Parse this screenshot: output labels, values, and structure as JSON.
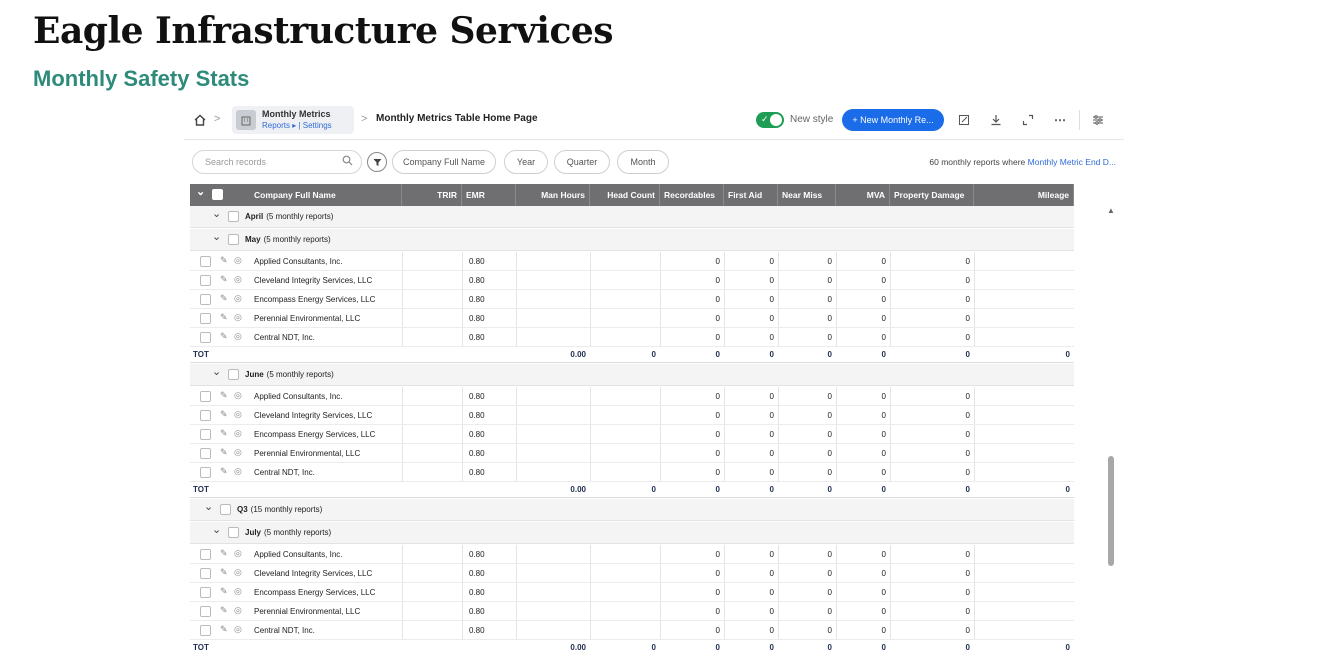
{
  "page": {
    "title": "Eagle Infrastructure Services",
    "subtitle": "Monthly Safety Stats"
  },
  "topbar": {
    "app_name": "Monthly Metrics",
    "links": "Reports ▸ | Settings",
    "page_name": "Monthly Metrics Table Home Page",
    "new_style_label": "New style",
    "new_button": "+ New Monthly Re...",
    "separator": ">"
  },
  "filters": {
    "search_placeholder": "Search records",
    "pills": [
      "Company Full Name",
      "Year",
      "Quarter",
      "Month"
    ],
    "count_text": "60 monthly reports where ",
    "count_link": "Monthly Metric End D..."
  },
  "table": {
    "columns": [
      "Company Full Name",
      "TRIR",
      "EMR",
      "Man Hours",
      "Head Count",
      "Recordables",
      "First Aid",
      "Near Miss",
      "MVA",
      "Property Damage",
      "Mileage"
    ],
    "companies": [
      "Applied Consultants, Inc.",
      "Cleveland Integrity Services, LLC",
      "Encompass Energy Services, LLC",
      "Perennial Environmental, LLC",
      "Central NDT, Inc."
    ],
    "emr": "0.80",
    "zero": "0",
    "tot_label": "TOT",
    "tot_values": [
      "0.00",
      "0",
      "0",
      "0",
      "0",
      "0",
      "0",
      "0"
    ],
    "groups": {
      "april": {
        "name": "April",
        "count": "(5 monthly reports)"
      },
      "may": {
        "name": "May",
        "count": "(5 monthly reports)"
      },
      "june": {
        "name": "June",
        "count": "(5 monthly reports)"
      },
      "q3": {
        "name": "Q3",
        "count": "(15 monthly reports)"
      },
      "july": {
        "name": "July",
        "count": "(5 monthly reports)"
      }
    }
  },
  "icons": {
    "home": "home-icon",
    "filter": "filter-icon",
    "search": "search-icon",
    "edit": "pencil-icon",
    "view": "eye-icon"
  },
  "colors": {
    "subtitle": "#2e8b7a",
    "header_bg": "#6f6f72",
    "primary_button": "#1a6ce8",
    "toggle_on": "#1f9d55"
  }
}
